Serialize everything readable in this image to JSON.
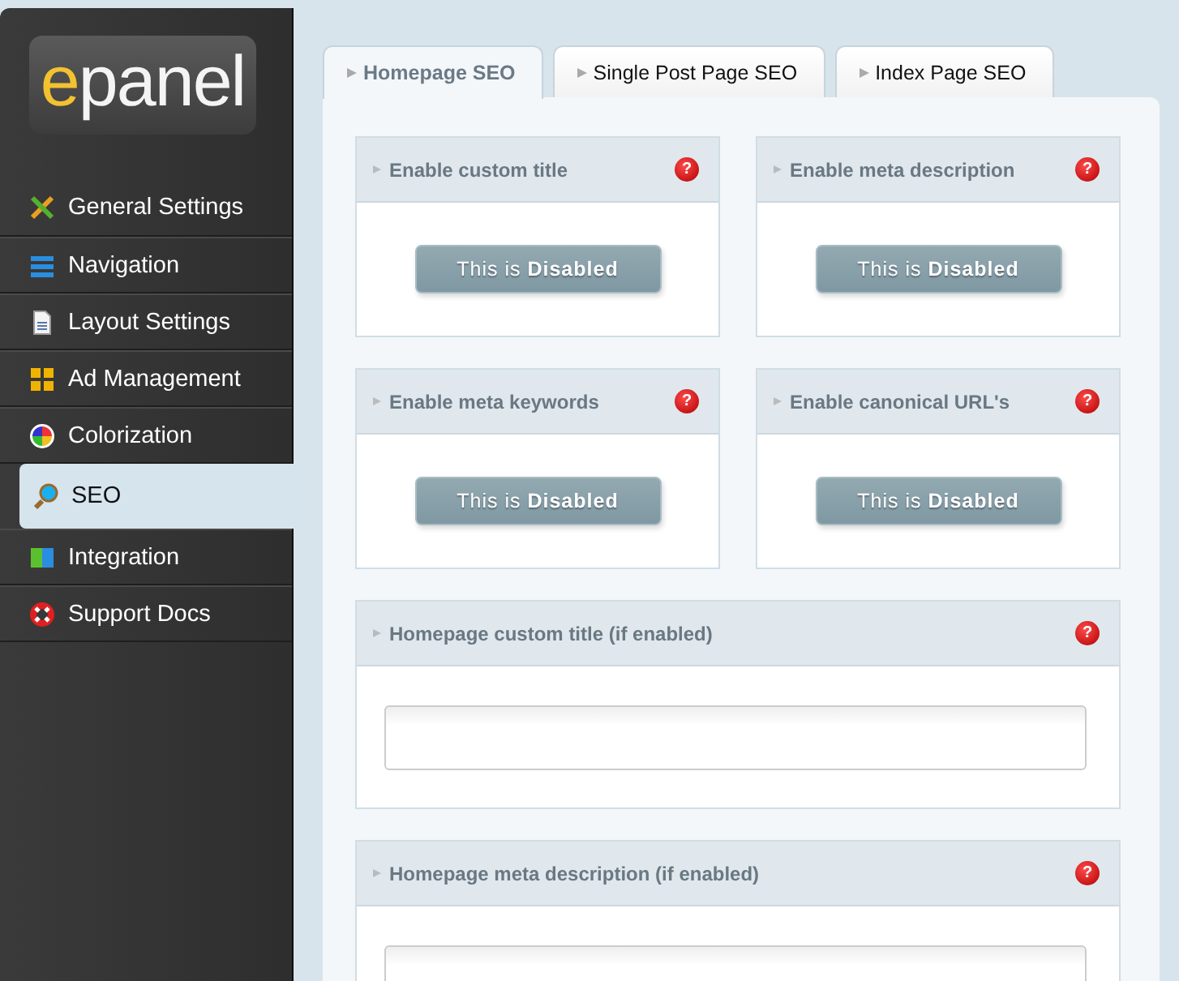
{
  "logo": {
    "accent": "e",
    "rest": "panel"
  },
  "sidebar": {
    "items": [
      {
        "label": "General Settings",
        "selected": false
      },
      {
        "label": "Navigation",
        "selected": false
      },
      {
        "label": "Layout Settings",
        "selected": false
      },
      {
        "label": "Ad Management",
        "selected": false
      },
      {
        "label": "Colorization",
        "selected": false
      },
      {
        "label": "SEO",
        "selected": true
      },
      {
        "label": "Integration",
        "selected": false
      },
      {
        "label": "Support Docs",
        "selected": false
      }
    ]
  },
  "tabs": [
    {
      "label": "Homepage SEO",
      "selected": true
    },
    {
      "label": "Single Post Page SEO",
      "selected": false
    },
    {
      "label": "Index Page SEO",
      "selected": false
    }
  ],
  "options": [
    {
      "kind": "toggle",
      "title": "Enable custom title",
      "help": "?",
      "button": "This is **Disabled**"
    },
    {
      "kind": "toggle",
      "title": "Enable meta description",
      "help": "?",
      "button": "This is **Disabled**"
    },
    {
      "kind": "toggle",
      "title": "Enable meta keywords",
      "help": "?",
      "button": "This is **Disabled**"
    },
    {
      "kind": "toggle",
      "title": "Enable canonical URL's",
      "help": "?",
      "button": "This is **Disabled**"
    },
    {
      "kind": "text",
      "title": "Homepage custom title (if enabled)",
      "help": "?"
    },
    {
      "kind": "text",
      "title": "Homepage meta description (if enabled)",
      "help": "?"
    }
  ]
}
